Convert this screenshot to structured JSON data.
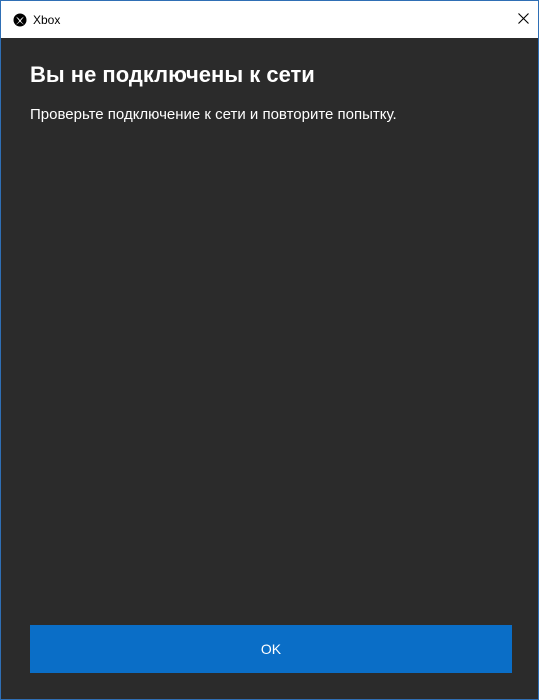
{
  "window": {
    "title": "Xbox",
    "icon": "xbox-icon",
    "close_icon": "close-icon"
  },
  "dialog": {
    "heading": "Вы не подключены к сети",
    "message": "Проверьте подключение к сети и повторите попытку.",
    "ok_label": "OK"
  },
  "colors": {
    "background": "#2b2b2b",
    "accent": "#0a6ec7",
    "text": "#ffffff"
  }
}
